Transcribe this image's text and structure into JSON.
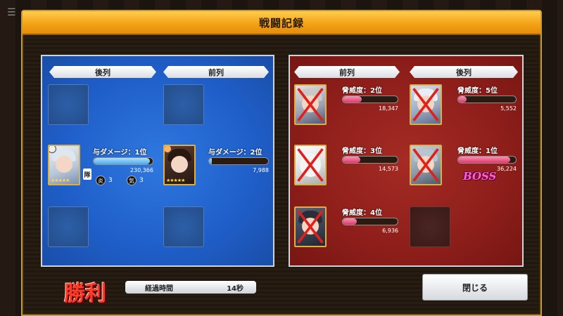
{
  "title": "戦闘記録",
  "colors": {
    "header": "#f3a417",
    "ally_panel": "#1f5ec8",
    "enemy_panel": "#8e1e1a",
    "victory": "#ff3a2a"
  },
  "ally": {
    "tabs": [
      "後列",
      "前列"
    ],
    "units": [
      {
        "rank_label": "与ダメージ：1位",
        "value": "230,366",
        "gauge_fill": 0.95,
        "stars": "★★★★★",
        "lead_badge": "隊",
        "stats": [
          {
            "icon": "炎",
            "value": "3"
          },
          {
            "icon": "気",
            "value": "3"
          }
        ]
      },
      {
        "rank_label": "与ダメージ：2位",
        "value": "7,988",
        "gauge_fill": 0.05,
        "stars": "★★★★★"
      }
    ]
  },
  "enemy": {
    "tabs": [
      "前列",
      "後列"
    ],
    "units": [
      {
        "rank_label": "脅威度：2位",
        "value": "18,347",
        "gauge_fill": 0.35
      },
      {
        "rank_label": "脅威度：5位",
        "value": "5,552",
        "gauge_fill": 0.15
      },
      {
        "rank_label": "脅威度：3位",
        "value": "14,573",
        "gauge_fill": 0.32
      },
      {
        "rank_label": "脅威度：1位",
        "value": "36,224",
        "gauge_fill": 0.9,
        "badge": "BOSS"
      },
      {
        "rank_label": "脅威度：4位",
        "value": "6,936",
        "gauge_fill": 0.25
      }
    ]
  },
  "footer": {
    "result": "勝利",
    "elapsed_label": "経過時間",
    "elapsed_value": "14秒",
    "close_label": "閉じる"
  }
}
